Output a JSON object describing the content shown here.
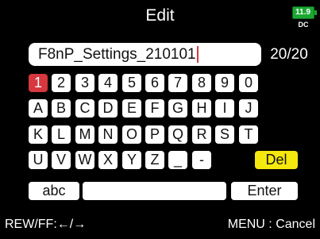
{
  "header": {
    "title": "Edit"
  },
  "battery": {
    "voltage": "11.9",
    "source": "DC",
    "color": "#1aa832"
  },
  "input": {
    "value": "F8nP_Settings_210101",
    "count": "20/20"
  },
  "keyboard": {
    "rows": [
      [
        "1",
        "2",
        "3",
        "4",
        "5",
        "6",
        "7",
        "8",
        "9",
        "0"
      ],
      [
        "A",
        "B",
        "C",
        "D",
        "E",
        "F",
        "G",
        "H",
        "I",
        "J"
      ],
      [
        "K",
        "L",
        "M",
        "N",
        "O",
        "P",
        "Q",
        "R",
        "S",
        "T"
      ],
      [
        "U",
        "V",
        "W",
        "X",
        "Y",
        "Z",
        "_",
        "-"
      ]
    ],
    "del_label": "Del",
    "abc_label": "abc",
    "space_label": "",
    "enter_label": "Enter",
    "selected_key": "1"
  },
  "footer": {
    "nav_hint": "REW/FF:←/→",
    "cancel_hint": "MENU : Cancel"
  },
  "colors": {
    "selected": "#d7373e",
    "delete": "#f5e80e",
    "background": "#000000"
  }
}
